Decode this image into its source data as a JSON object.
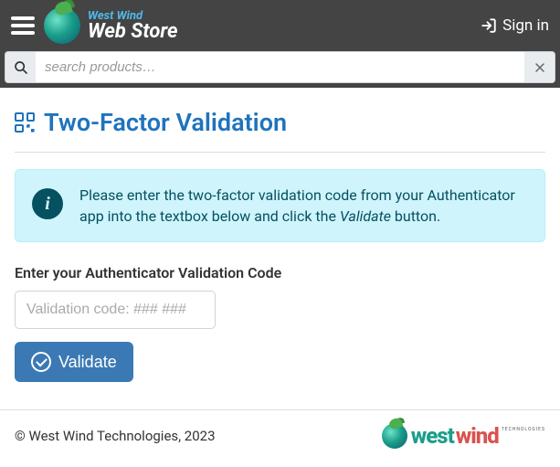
{
  "header": {
    "brand_top": "West Wind",
    "brand_bottom": "Web Store",
    "signin_label": "Sign in"
  },
  "search": {
    "placeholder": "search products…",
    "value": ""
  },
  "page": {
    "title": "Two-Factor Validation"
  },
  "info": {
    "text_before": "Please enter the two-factor validation code from your Authenticator app into the textbox below and click the ",
    "text_em": "Validate",
    "text_after": " button."
  },
  "form": {
    "label": "Enter your Authenticator Validation Code",
    "placeholder": "Validation code: ### ###",
    "value": "",
    "submit_label": "Validate"
  },
  "footer": {
    "copyright": "© West Wind Technologies, 2023",
    "logo_west": "west",
    "logo_wind": "wind",
    "logo_tag": "TECHNOLOGIES"
  }
}
